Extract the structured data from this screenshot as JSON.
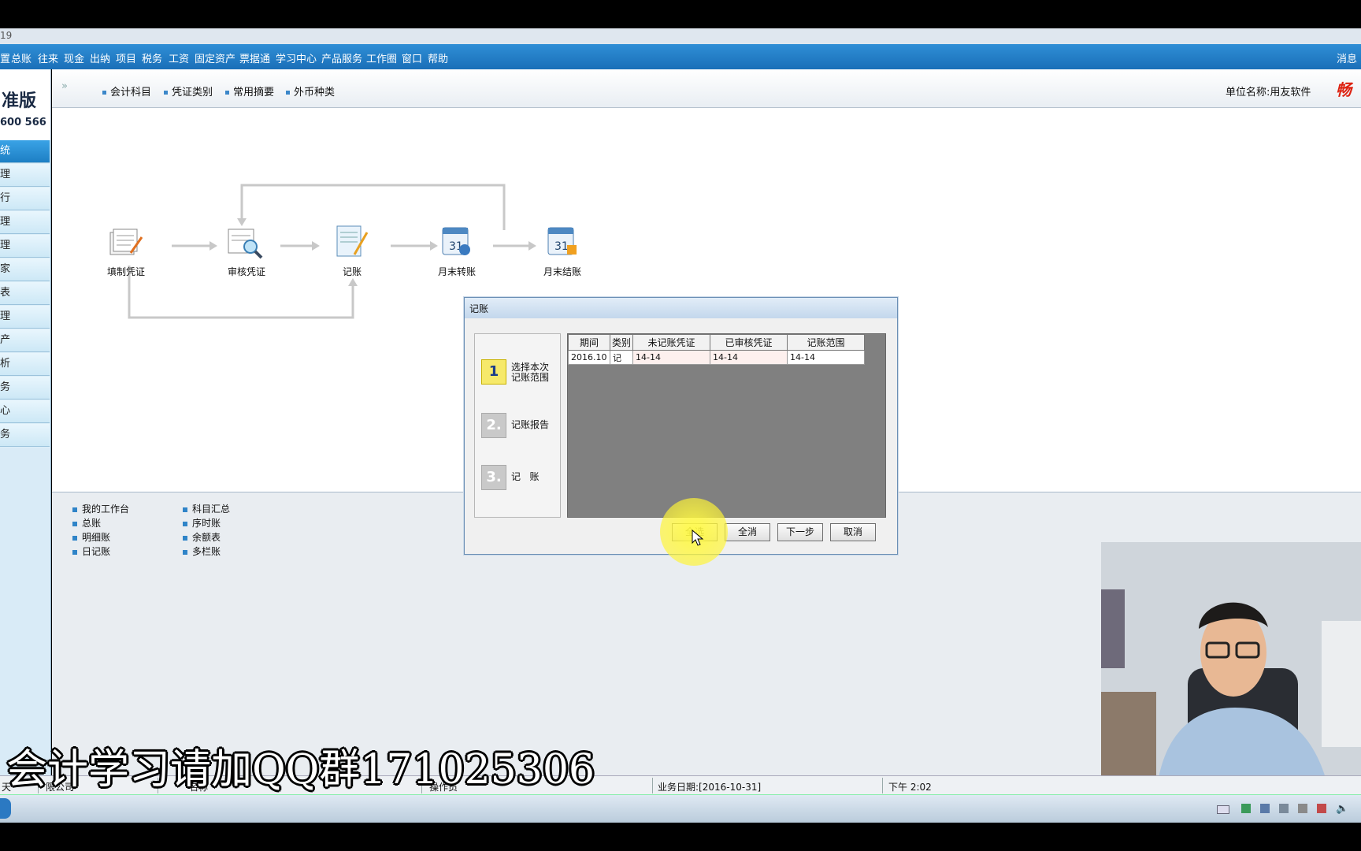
{
  "window": {
    "title_fragment": "19"
  },
  "menu": {
    "items": [
      "置",
      "总账",
      "往来",
      "现金",
      "出纳",
      "项目",
      "税务",
      "工资",
      "固定资产",
      "票据通",
      "学习中心",
      "产品服务",
      "工作圈",
      "窗口",
      "帮助"
    ],
    "right": "消息"
  },
  "toolbar": {
    "items": [
      "会计科目",
      "凭证类别",
      "常用摘要",
      "外币种类"
    ],
    "unit_label": "单位名称:用友软件",
    "brand": "畅"
  },
  "logo": {
    "line1": "准版",
    "line2": "600 566"
  },
  "nav": {
    "items": [
      "统",
      "理",
      "行",
      "理",
      "理",
      "家",
      "表",
      "理",
      "产",
      "析",
      "务",
      "心",
      "务"
    ]
  },
  "flow": {
    "steps": [
      "填制凭证",
      "审核凭证",
      "记账",
      "月末转账",
      "月末结账"
    ]
  },
  "quick_links": {
    "col1": [
      "我的工作台",
      "总账",
      "明细账",
      "日记账"
    ],
    "col2": [
      "科目汇总",
      "序时账",
      "余额表",
      "多栏账"
    ]
  },
  "dialog": {
    "title": "记账",
    "steps": [
      {
        "num": "1",
        "label_line1": "选择本次",
        "label_line2": "记账范围"
      },
      {
        "num": "2.",
        "label": "记账报告"
      },
      {
        "num": "3.",
        "label": "记   账"
      }
    ],
    "table": {
      "headers": [
        "期间",
        "类别",
        "未记账凭证",
        "已审核凭证",
        "记账范围"
      ],
      "rows": [
        [
          "2016.10",
          "记",
          "14-14",
          "14-14",
          "14-14"
        ]
      ]
    },
    "buttons": [
      "全选",
      "全消",
      "下一步",
      "取消"
    ]
  },
  "status": {
    "seg1": "天",
    "seg2": "限公司",
    "seg3": "名称",
    "seg4": "操作员",
    "biz_date": "业务日期:[2016-10-31]",
    "time": "下午 2:02"
  },
  "banner": "会计学习请加QQ群171025306"
}
